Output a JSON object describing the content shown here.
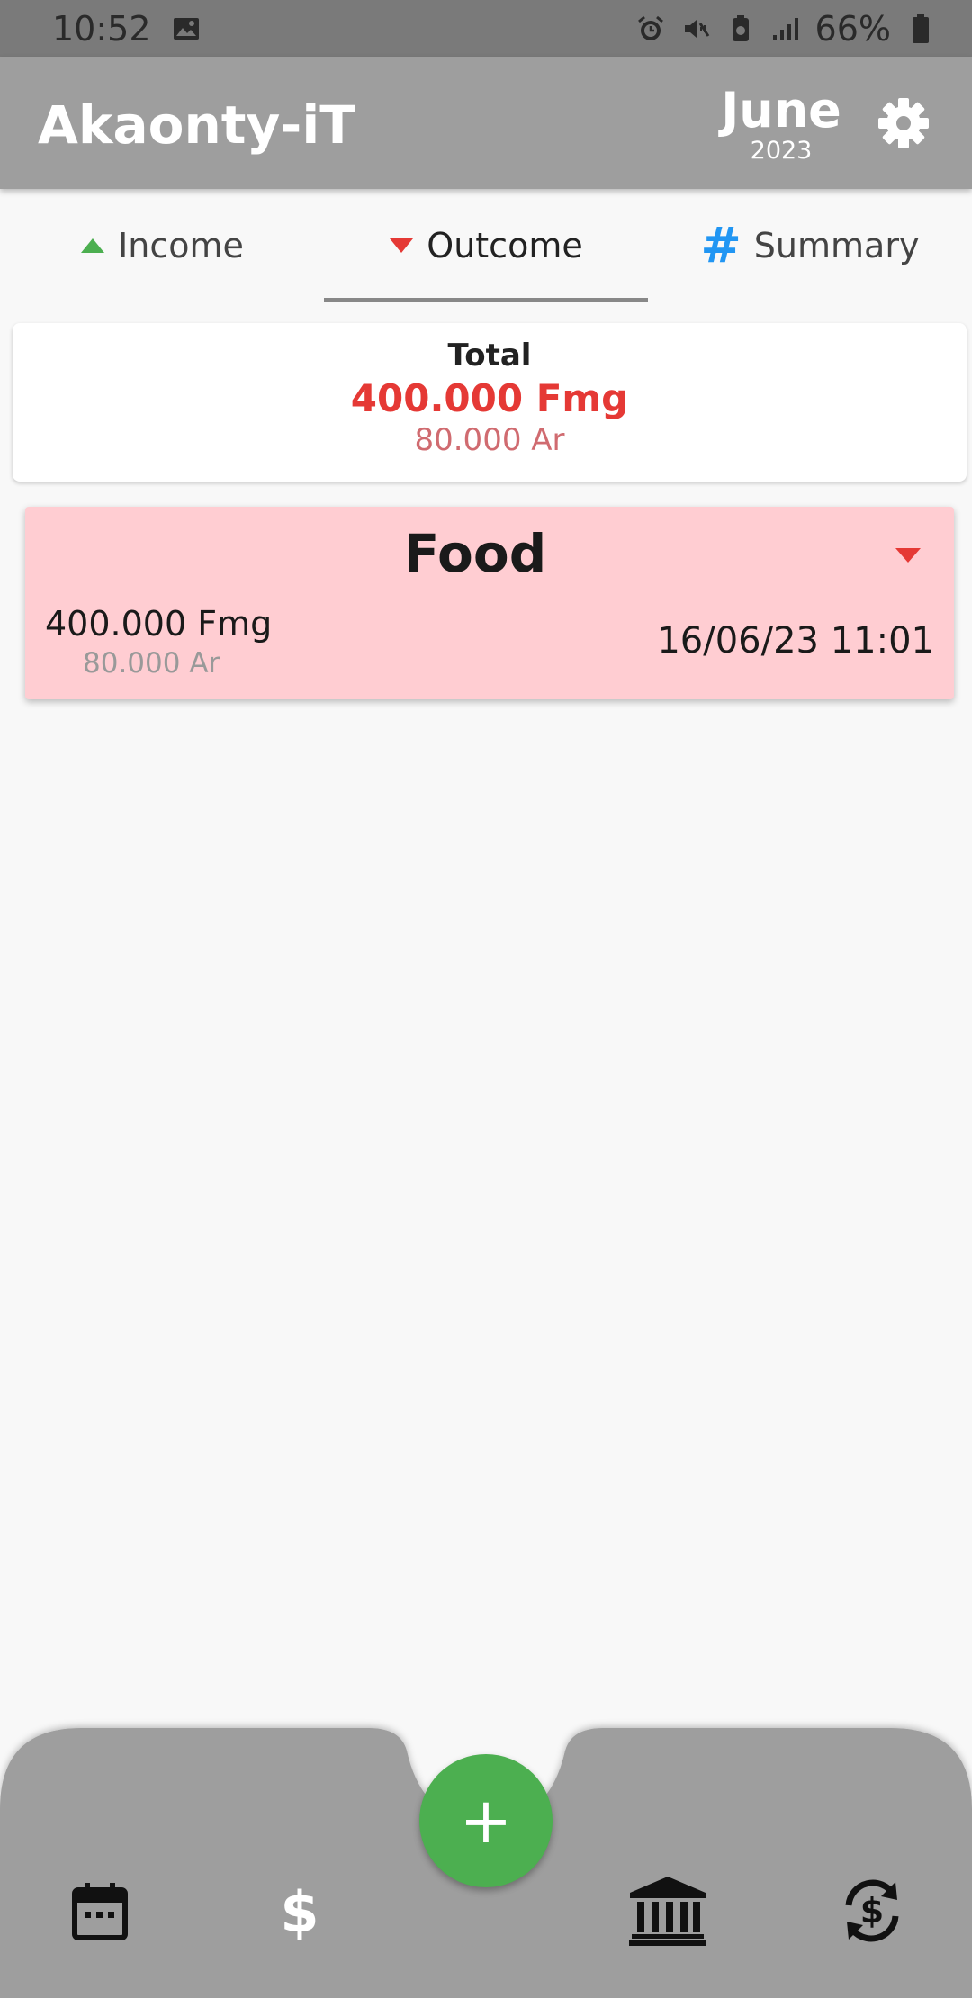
{
  "status_bar": {
    "time": "10:52",
    "battery": "66%"
  },
  "app_bar": {
    "title": "Akaonty-iT",
    "month": "June",
    "year": "2023"
  },
  "tabs": [
    {
      "label": "Income",
      "icon": "triangle-up-icon",
      "color": "#4caf50"
    },
    {
      "label": "Outcome",
      "icon": "triangle-down-icon",
      "color": "#e53935",
      "active": true
    },
    {
      "label": "Summary",
      "icon": "hash-icon",
      "color": "#2196f3"
    }
  ],
  "total": {
    "label": "Total",
    "amount": "400.000 Fmg",
    "secondary": "80.000 Ar",
    "amount_color": "#e53935",
    "secondary_color": "#d06b70"
  },
  "entries": [
    {
      "category": "Food",
      "amount": "400.000 Fmg",
      "secondary": "80.000 Ar",
      "date": "16/06/23 11:01",
      "background": "#ffcdd2"
    }
  ],
  "bottom_nav": {
    "items": [
      "calendar-icon",
      "dollar-icon",
      "bank-icon",
      "currency-exchange-icon"
    ],
    "fab_icon": "plus-icon",
    "fab_label": "+",
    "fab_color": "#4caf50",
    "bar_color": "#9e9e9e"
  }
}
